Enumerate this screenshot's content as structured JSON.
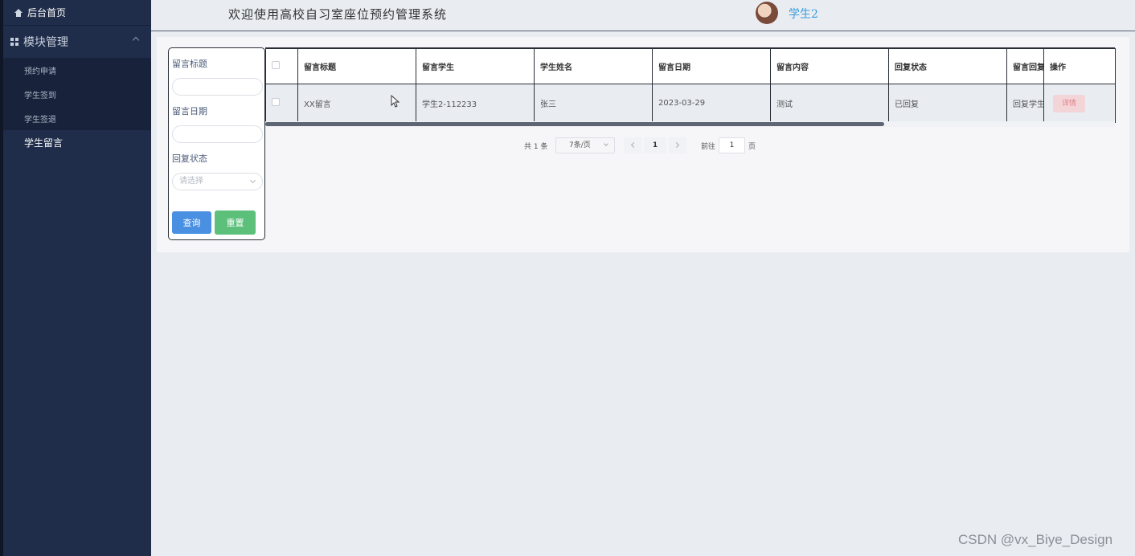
{
  "sidebar": {
    "home_label": "后台首页",
    "module_label": "模块管理",
    "sub_items": [
      "预约申请",
      "学生签到",
      "学生签退"
    ],
    "active_item": "学生留言"
  },
  "header": {
    "title": "欢迎使用高校自习室座位预约管理系统",
    "username": "学生2"
  },
  "search": {
    "title_label": "留言标题",
    "title_value": "",
    "date_label": "留言日期",
    "date_value": "",
    "status_label": "回复状态",
    "status_placeholder": "请选择",
    "query_label": "查询",
    "reset_label": "重置"
  },
  "table": {
    "columns": [
      "留言标题",
      "留言学生",
      "学生姓名",
      "留言日期",
      "留言内容",
      "回复状态",
      "留言回复",
      "操作"
    ],
    "rows": [
      {
        "title": "XX留言",
        "student": "学生2-112233",
        "name": "张三",
        "date": "2023-03-29",
        "content": "测试",
        "status": "已回复",
        "reply": "回复学生",
        "action": "详情"
      }
    ]
  },
  "pagination": {
    "total": "共 1 条",
    "page_size": "7条/页",
    "current_page": "1",
    "goto_label": "前往",
    "goto_value": "1",
    "page_suffix": "页"
  },
  "watermark": "CSDN @vx_Biye_Design",
  "colors": {
    "sidebar_bg": "#1f2d4a",
    "query_button": "#4a90e2",
    "reset_button": "#5cc07a",
    "username": "#3a9ad9",
    "detail_button_bg": "#f3d5d8"
  }
}
